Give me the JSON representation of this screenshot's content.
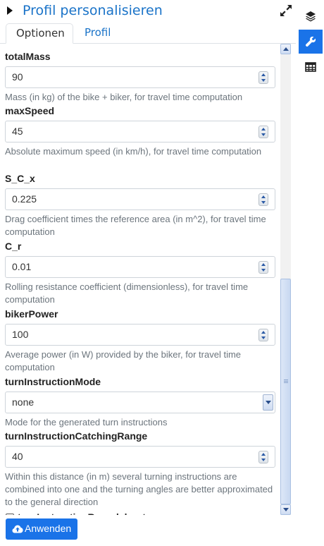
{
  "header": {
    "title": "Profil personalisieren"
  },
  "tabs": [
    {
      "label": "Optionen",
      "active": true
    },
    {
      "label": "Profil",
      "active": false
    }
  ],
  "fields": {
    "totalMass": {
      "label": "totalMass",
      "value": "90",
      "desc": "Mass (in kg) of the bike + biker, for travel time computation"
    },
    "maxSpeed": {
      "label": "maxSpeed",
      "value": "45",
      "desc": "Absolute maximum speed (in km/h), for travel time computation"
    },
    "S_C_x": {
      "label": "S_C_x",
      "value": "0.225",
      "desc": "Drag coefficient times the reference area (in m^2), for travel time computation"
    },
    "C_r": {
      "label": "C_r",
      "value": "0.01",
      "desc": "Rolling resistance coefficient (dimensionless), for travel time computation"
    },
    "bikerPower": {
      "label": "bikerPower",
      "value": "100",
      "desc": "Average power (in W) provided by the biker, for travel time computation"
    },
    "turnInstructionMode": {
      "label": "turnInstructionMode",
      "value": "none",
      "desc": "Mode for the generated turn instructions"
    },
    "turnInstructionCatchingRange": {
      "label": "turnInstructionCatchingRange",
      "value": "40",
      "desc": "Within this distance (in m) several turning instructions are combined into one and the turning angles are better approximated to the general direction"
    }
  },
  "partial_checkbox_label": "turnInstructionRoundabouts",
  "footer": {
    "apply_label": "Anwenden"
  },
  "colors": {
    "accent": "#1a73e8",
    "link": "#1a73c8"
  },
  "icons": {
    "rail": [
      "layers-icon",
      "wrench-icon",
      "table-icon"
    ],
    "expand": "expand-icon",
    "apply": "cloud-upload-icon"
  }
}
